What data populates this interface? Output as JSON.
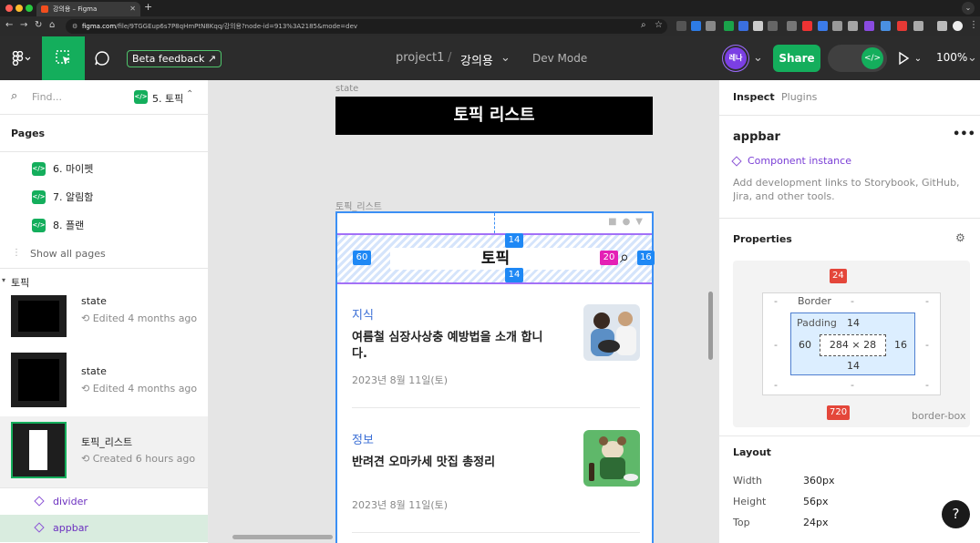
{
  "browser": {
    "tab_title": "강의용 – Figma",
    "url_host": "figma.com",
    "url_path": "/file/9TGGEup6s7P8qHmPtN8Kqq/강의용?node-id=913%3A2185&mode=dev"
  },
  "toolbar": {
    "beta_feedback": "Beta feedback",
    "project": "project1",
    "separator": "/",
    "file_name": "강의용",
    "mode": "Dev Mode",
    "avatar": "레나",
    "share": "Share",
    "zoom": "100%"
  },
  "left": {
    "search_placeholder": "Find...",
    "current_page": "5. 토픽",
    "pages_title": "Pages",
    "pages": [
      "6. 마이펫",
      "7. 알림함",
      "8. 플랜"
    ],
    "show_all": "Show all pages",
    "section": "토픽",
    "frames": [
      {
        "title": "state",
        "sub": "Edited 4 months ago"
      },
      {
        "title": "state",
        "sub": "Edited 4 months ago"
      },
      {
        "title": "토픽_리스트",
        "sub": "Created 6 hours ago"
      }
    ],
    "components": [
      "divider",
      "appbar"
    ]
  },
  "canvas": {
    "state_label": "state",
    "state_title": "토픽 리스트",
    "frame_label": "토픽_리스트",
    "appbar_title": "토픽",
    "spacing": {
      "top": "14",
      "bottom": "14",
      "left": "60",
      "right": "16",
      "gap": "20"
    },
    "feed": [
      {
        "category": "지식",
        "title": "여름철 심장사상충 예방법을 소개 합니다.",
        "date": "2023년 8월 11일(토)"
      },
      {
        "category": "정보",
        "title": "반려견 오마카세 맛집 총정리",
        "date": "2023년 8월 11일(토)"
      }
    ]
  },
  "right": {
    "tab_inspect": "Inspect",
    "tab_plugins": "Plugins",
    "layer_name": "appbar",
    "component_instance": "Component instance",
    "hint": "Add development links to Storybook, GitHub, Jira, and other tools.",
    "properties": "Properties",
    "box": {
      "top": "24",
      "bottom": "720",
      "border": "Border",
      "padding": "Padding",
      "pad_top": "14",
      "pad_bottom": "14",
      "pad_left": "60",
      "pad_right": "16",
      "size": "284 × 28",
      "dash": "-",
      "box_sizing": "border-box"
    },
    "layout": "Layout",
    "props": [
      {
        "k": "Width",
        "v": "360px"
      },
      {
        "k": "Height",
        "v": "56px"
      },
      {
        "k": "Top",
        "v": "24px"
      }
    ],
    "help": "?"
  }
}
